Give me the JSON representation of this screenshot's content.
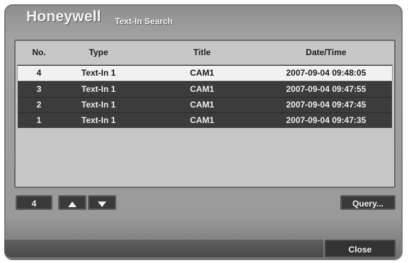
{
  "header": {
    "brand": "Honeywell",
    "title": "Text-In Search"
  },
  "table": {
    "columns": [
      "No.",
      "Type",
      "Title",
      "Date/Time"
    ],
    "rows": [
      {
        "no": "4",
        "type": "Text-In 1",
        "title": "CAM1",
        "datetime": "2007-09-04 09:48:05",
        "selected": true
      },
      {
        "no": "3",
        "type": "Text-In 1",
        "title": "CAM1",
        "datetime": "2007-09-04 09:47:55",
        "selected": false
      },
      {
        "no": "2",
        "type": "Text-In 1",
        "title": "CAM1",
        "datetime": "2007-09-04 09:47:45",
        "selected": false
      },
      {
        "no": "1",
        "type": "Text-In 1",
        "title": "CAM1",
        "datetime": "2007-09-04 09:47:35",
        "selected": false
      }
    ]
  },
  "controls": {
    "count": "4",
    "up_icon": "triangle-up-icon",
    "down_icon": "triangle-down-icon",
    "query_label": "Query...",
    "close_label": "Close"
  },
  "colors": {
    "panel": "#a3a3a3",
    "row_dark": "#3c3c3c",
    "row_selected": "#f1f1f1",
    "button": "#3a3a3a"
  }
}
